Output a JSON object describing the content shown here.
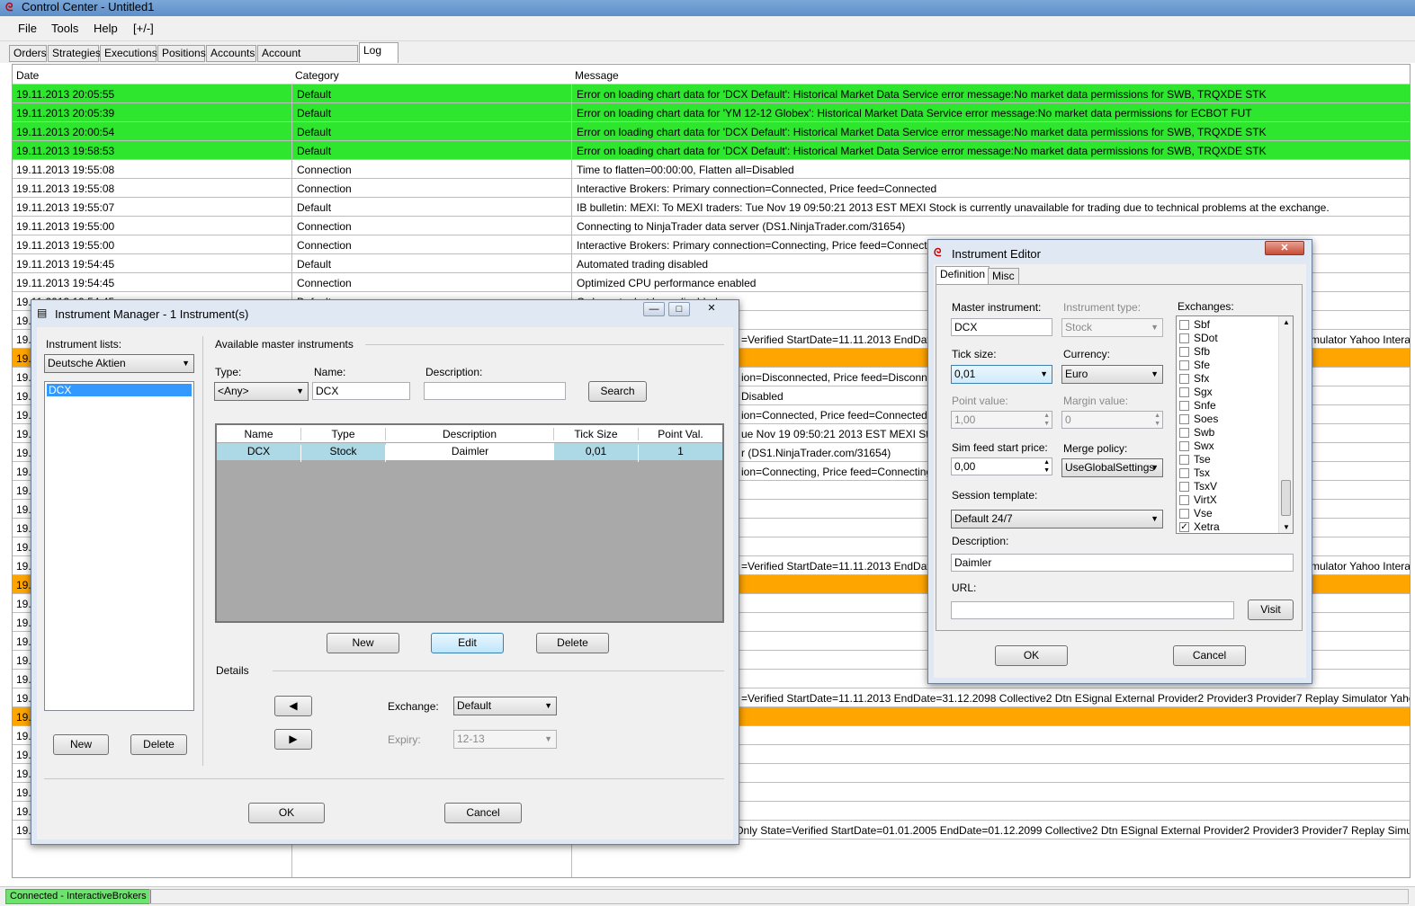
{
  "app": {
    "title": "Control Center - Untitled1"
  },
  "menu": [
    "File",
    "Tools",
    "Help",
    "[+/-]"
  ],
  "tabs": [
    "Orders",
    "Strategies",
    "Executions",
    "Positions",
    "Accounts",
    "Account Performance",
    "Log"
  ],
  "log": {
    "headers": {
      "date": "Date",
      "category": "Category",
      "message": "Message"
    },
    "rows": [
      {
        "date": "19.11.2013 20:05:55",
        "category": "Default",
        "message": "Error on loading chart data for 'DCX Default': Historical Market Data Service error message:No market data permissions for SWB, TRQXDE STK",
        "color": "green"
      },
      {
        "date": "19.11.2013 20:05:39",
        "category": "Default",
        "message": "Error on loading chart data for 'YM 12-12 Globex': Historical Market Data Service error message:No market data permissions for ECBOT FUT",
        "color": "green"
      },
      {
        "date": "19.11.2013 20:00:54",
        "category": "Default",
        "message": "Error on loading chart data for 'DCX Default': Historical Market Data Service error message:No market data permissions for SWB, TRQXDE STK",
        "color": "green"
      },
      {
        "date": "19.11.2013 19:58:53",
        "category": "Default",
        "message": "Error on loading chart data for 'DCX Default': Historical Market Data Service error message:No market data permissions for SWB, TRQXDE STK",
        "color": "green"
      },
      {
        "date": "19.11.2013 19:55:08",
        "category": "Connection",
        "message": "Time to flatten=00:00:00, Flatten all=Disabled",
        "color": "white"
      },
      {
        "date": "19.11.2013 19:55:08",
        "category": "Connection",
        "message": "Interactive Brokers: Primary connection=Connected, Price feed=Connected",
        "color": "white"
      },
      {
        "date": "19.11.2013 19:55:07",
        "category": "Default",
        "message": "IB bulletin: MEXI: To MEXI traders: Tue Nov 19 09:50:21 2013 EST MEXI Stock is currently unavailable for trading due to technical problems at the exchange.",
        "color": "white"
      },
      {
        "date": "19.11.2013 19:55:00",
        "category": "Connection",
        "message": "Connecting to NinjaTrader data server (DS1.NinjaTrader.com/31654)",
        "color": "white"
      },
      {
        "date": "19.11.2013 19:55:00",
        "category": "Connection",
        "message": "Interactive Brokers: Primary connection=Connecting, Price feed=Connecting",
        "color": "white"
      },
      {
        "date": "19.11.2013 19:54:45",
        "category": "Default",
        "message": "Automated trading disabled",
        "color": "white"
      },
      {
        "date": "19.11.2013 19:54:45",
        "category": "Connection",
        "message": "Optimized CPU performance enabled",
        "color": "white"
      },
      {
        "date": "19.11.2013 19:54:45",
        "category": "Default",
        "message": "Order entry hot keys disabled",
        "color": "white"
      },
      {
        "date": "19.",
        "category": "",
        "message": "",
        "color": "white"
      },
      {
        "date": "19.",
        "category": "",
        "message": "=Verified StartDate=11.11.2013 EndDate=",
        "message_right": "mulator Yahoo Interac",
        "color": "white"
      },
      {
        "date": "19.",
        "category": "",
        "message": "",
        "color": "orange"
      },
      {
        "date": "19.",
        "category": "",
        "message": "ion=Disconnected, Price feed=Disconnecte",
        "color": "white"
      },
      {
        "date": "19.",
        "category": "",
        "message": "Disabled",
        "color": "white"
      },
      {
        "date": "19.",
        "category": "",
        "message": "ion=Connected, Price feed=Connected",
        "color": "white"
      },
      {
        "date": "19.",
        "category": "",
        "message": "ue Nov 19 09:50:21 2013 EST MEXI Stock",
        "color": "white"
      },
      {
        "date": "19.",
        "category": "",
        "message": "r (DS1.NinjaTrader.com/31654)",
        "color": "white"
      },
      {
        "date": "19.",
        "category": "",
        "message": "ion=Connecting, Price feed=Connecting",
        "color": "white"
      },
      {
        "date": "19.",
        "category": "",
        "message": "",
        "color": "white"
      },
      {
        "date": "19.",
        "category": "",
        "message": "",
        "color": "white"
      },
      {
        "date": "19.",
        "category": "",
        "message": "",
        "color": "white"
      },
      {
        "date": "19.",
        "category": "",
        "message": "",
        "color": "white"
      },
      {
        "date": "19.",
        "category": "",
        "message": "=Verified StartDate=11.11.2013 EndDate=",
        "message_right": "mulator Yahoo Interac",
        "color": "white"
      },
      {
        "date": "19.",
        "category": "",
        "message": "",
        "color": "orange"
      },
      {
        "date": "19.",
        "category": "",
        "message": "",
        "color": "white"
      },
      {
        "date": "19.",
        "category": "",
        "message": "",
        "color": "white"
      },
      {
        "date": "19.",
        "category": "",
        "message": "",
        "color": "white"
      },
      {
        "date": "19.",
        "category": "",
        "message": "",
        "color": "white"
      },
      {
        "date": "19.",
        "category": "",
        "message": "",
        "color": "white"
      },
      {
        "date": "19.",
        "category": "",
        "message": "=Verified StartDate=11.11.2013 EndDate=31.12.2098 Collective2 Dtn ESignal External Provider2 Provider3 Provider7 Replay Simulator Yahoo Interac",
        "color": "white"
      },
      {
        "date": "19.",
        "category": "",
        "message": "",
        "color": "orange"
      },
      {
        "date": "19.",
        "category": "",
        "message": "",
        "color": "white"
      },
      {
        "date": "19.",
        "category": "",
        "message": "",
        "color": "white"
      },
      {
        "date": "19.",
        "category": "",
        "message": "",
        "color": "white"
      },
      {
        "date": "19.",
        "category": "",
        "message": "",
        "color": "white"
      },
      {
        "date": "19.",
        "category": "",
        "message": "",
        "color": "white"
      },
      {
        "date": "19.11.2013 19:49:53",
        "category": "Default",
        "message": "Current license: Type=SimulationOnly State=Verified StartDate=01.01.2005 EndDate=01.12.2099 Collective2 Dtn ESignal External Provider2 Provider3 Provider7 Replay Simulator Yahoo C",
        "color": "white"
      }
    ]
  },
  "status": {
    "connection": "Connected - InteractiveBrokers"
  },
  "instrument_manager": {
    "title": "Instrument Manager - 1 Instrument(s)",
    "lists_label": "Instrument lists:",
    "list_selected": "Deutsche Aktien",
    "list_items": [
      "DCX"
    ],
    "new": "New",
    "delete": "Delete",
    "available_label": "Available master instruments",
    "type_label": "Type:",
    "type_value": "<Any>",
    "name_label": "Name:",
    "name_value": "DCX",
    "desc_label": "Description:",
    "desc_value": "",
    "search": "Search",
    "grid_headers": [
      "Name",
      "Type",
      "Description",
      "Tick Size",
      "Point Val."
    ],
    "grid_row": [
      "DCX",
      "Stock",
      "Daimler",
      "0,01",
      "1"
    ],
    "grid_new": "New",
    "grid_edit": "Edit",
    "grid_delete": "Delete",
    "details_label": "Details",
    "exchange_label": "Exchange:",
    "exchange_value": "Default",
    "expiry_label": "Expiry:",
    "expiry_value": "12-13",
    "ok": "OK",
    "cancel": "Cancel"
  },
  "instrument_editor": {
    "title": "Instrument Editor",
    "tabs": [
      "Definition",
      "Misc"
    ],
    "master_label": "Master instrument:",
    "master_value": "DCX",
    "itype_label": "Instrument type:",
    "itype_value": "Stock",
    "exchanges_label": "Exchanges:",
    "tick_label": "Tick size:",
    "tick_value": "0,01",
    "currency_label": "Currency:",
    "currency_value": "Euro",
    "point_label": "Point value:",
    "point_value": "1,00",
    "margin_label": "Margin value:",
    "margin_value": "0",
    "simfeed_label": "Sim feed start price:",
    "simfeed_value": "0,00",
    "merge_label": "Merge policy:",
    "merge_value": "UseGlobalSettings",
    "session_label": "Session template:",
    "session_value": "Default 24/7",
    "description_label": "Description:",
    "description_value": "Daimler",
    "url_label": "URL:",
    "url_value": "",
    "visit": "Visit",
    "ok": "OK",
    "cancel": "Cancel",
    "exchanges": [
      {
        "name": "Sbf",
        "checked": false
      },
      {
        "name": "SDot",
        "checked": false
      },
      {
        "name": "Sfb",
        "checked": false
      },
      {
        "name": "Sfe",
        "checked": false
      },
      {
        "name": "Sfx",
        "checked": false
      },
      {
        "name": "Sgx",
        "checked": false
      },
      {
        "name": "Snfe",
        "checked": false
      },
      {
        "name": "Soes",
        "checked": false
      },
      {
        "name": "Swb",
        "checked": false
      },
      {
        "name": "Swx",
        "checked": false
      },
      {
        "name": "Tse",
        "checked": false
      },
      {
        "name": "Tsx",
        "checked": false
      },
      {
        "name": "TsxV",
        "checked": false
      },
      {
        "name": "VirtX",
        "checked": false
      },
      {
        "name": "Vse",
        "checked": false
      },
      {
        "name": "Xetra",
        "checked": true
      }
    ]
  }
}
